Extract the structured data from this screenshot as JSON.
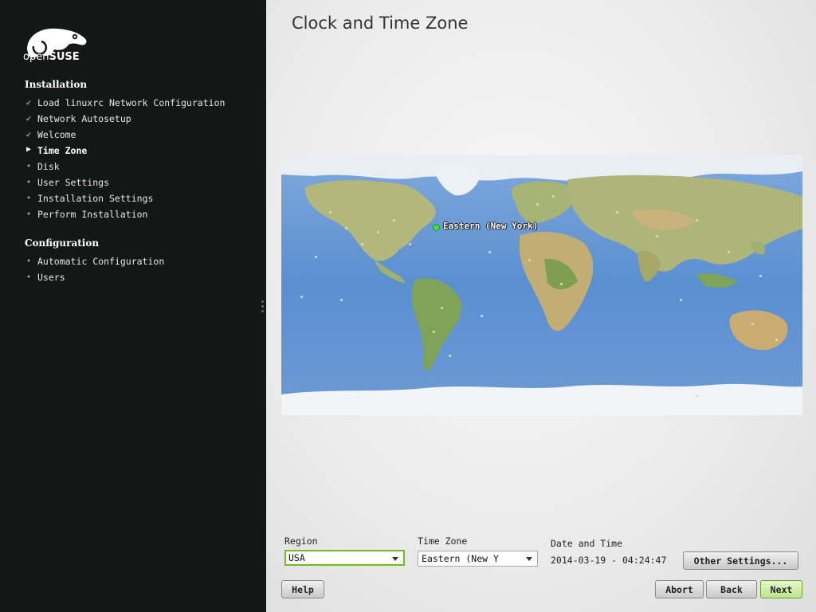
{
  "sidebar": {
    "logo_text_light": "open",
    "logo_text_bold": "SUSE",
    "installation_title": "Installation",
    "installation_steps": [
      {
        "label": "Load linuxrc Network Configuration",
        "state": "done"
      },
      {
        "label": "Network Autosetup",
        "state": "done"
      },
      {
        "label": "Welcome",
        "state": "done"
      },
      {
        "label": "Time Zone",
        "state": "current"
      },
      {
        "label": "Disk",
        "state": "pending"
      },
      {
        "label": "User Settings",
        "state": "pending"
      },
      {
        "label": "Installation Settings",
        "state": "pending"
      },
      {
        "label": "Perform Installation",
        "state": "pending"
      }
    ],
    "configuration_title": "Configuration",
    "configuration_steps": [
      {
        "label": "Automatic Configuration",
        "state": "pending"
      },
      {
        "label": "Users",
        "state": "pending"
      }
    ]
  },
  "main": {
    "title": "Clock and Time Zone",
    "map": {
      "selected_zone_label": "Eastern (New York)"
    },
    "region": {
      "label": "Region",
      "value": "USA"
    },
    "timezone": {
      "label": "Time Zone",
      "value": "Eastern (New Y"
    },
    "datetime": {
      "label": "Date and Time",
      "value": "2014-03-19 - 04:24:47"
    },
    "other_settings_label": "Other Settings..."
  },
  "buttons": {
    "help": "Help",
    "abort": "Abort",
    "back": "Back",
    "next": "Next"
  },
  "colors": {
    "sidebar_bg": "#151716",
    "accent_green": "#73ba25",
    "ocean": "#5b8fcf",
    "land": "#b6b77a"
  },
  "icons": {
    "done": "checkmark-icon",
    "current": "triangle-right-icon",
    "pending": "bullet-icon"
  }
}
